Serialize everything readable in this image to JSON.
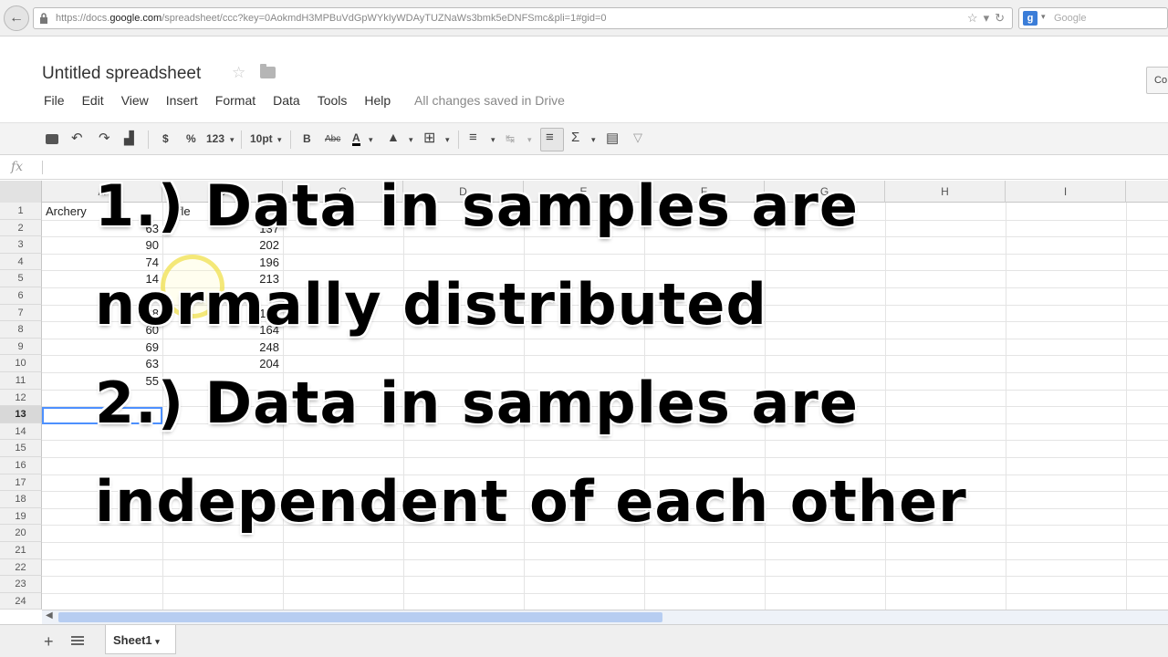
{
  "browser": {
    "url_prefix": "https://docs.",
    "url_host": "google.com",
    "url_rest": "/spreadsheet/ccc?key=0AokmdH3MPBuVdGpWYkIyWDAyTUZNaWs3bmk5eDNFSmc&pli=1#gid=0",
    "search_placeholder": "Google"
  },
  "doc": {
    "title": "Untitled spreadsheet",
    "saved_status": "All changes saved in Drive",
    "share_label": "Co"
  },
  "menu": [
    "File",
    "Edit",
    "View",
    "Insert",
    "Format",
    "Data",
    "Tools",
    "Help"
  ],
  "toolbar": {
    "currency": "$",
    "percent": "%",
    "number_format": "123",
    "font_size": "10pt",
    "bold": "B",
    "strike": "Abc",
    "text_color": "A",
    "sum": "Σ"
  },
  "formula_bar": {
    "label": "fx"
  },
  "grid": {
    "columns": [
      "A",
      "B",
      "C",
      "D",
      "E",
      "F",
      "G",
      "H",
      "I"
    ],
    "rows": [
      "1",
      "2",
      "3",
      "4",
      "5",
      "6",
      "7",
      "8",
      "9",
      "10",
      "11",
      "12",
      "13",
      "14",
      "15",
      "16",
      "17",
      "18",
      "19",
      "20",
      "21",
      "22",
      "23",
      "24"
    ],
    "selected_row": "13",
    "header_a": "Archery",
    "header_b": "ifle",
    "col_a_values": [
      "63",
      "90",
      "74",
      "14",
      "1",
      "88",
      "60",
      "69",
      "63",
      "55"
    ],
    "col_b_values": [
      "137",
      "202",
      "196",
      "213",
      "11",
      "144",
      "164",
      "248",
      "204"
    ]
  },
  "sheets": {
    "tab_label": "Sheet1"
  },
  "overlay": {
    "line1": "1.) Data in samples are",
    "line2": "normally distributed",
    "line3": "2.) Data in samples are",
    "line4": "independent of each other"
  }
}
